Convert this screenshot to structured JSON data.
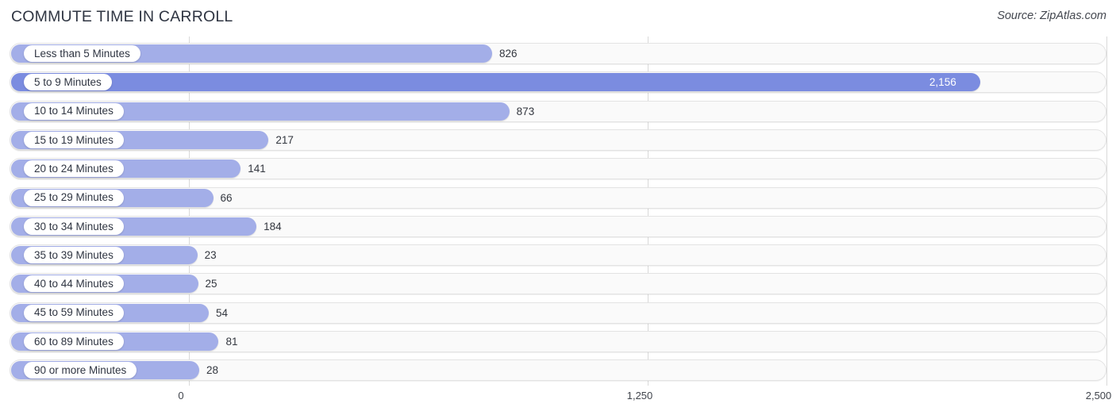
{
  "header": {
    "title": "COMMUTE TIME IN CARROLL",
    "source": "Source: ZipAtlas.com"
  },
  "chart_data": {
    "type": "bar",
    "orientation": "horizontal",
    "title": "COMMUTE TIME IN CARROLL",
    "xlabel": "",
    "ylabel": "",
    "xlim": [
      0,
      2500
    ],
    "grid": true,
    "legend": "none",
    "xticks": [
      0,
      1250,
      2500
    ],
    "xtick_labels": [
      "0",
      "1,250",
      "2,500"
    ],
    "categories": [
      "Less than 5 Minutes",
      "5 to 9 Minutes",
      "10 to 14 Minutes",
      "15 to 19 Minutes",
      "20 to 24 Minutes",
      "25 to 29 Minutes",
      "30 to 34 Minutes",
      "35 to 39 Minutes",
      "40 to 44 Minutes",
      "45 to 59 Minutes",
      "60 to 89 Minutes",
      "90 or more Minutes"
    ],
    "values": [
      826,
      2156,
      873,
      217,
      141,
      66,
      184,
      23,
      25,
      54,
      81,
      28
    ],
    "value_labels": [
      "826",
      "2,156",
      "873",
      "217",
      "141",
      "66",
      "184",
      "23",
      "25",
      "54",
      "81",
      "28"
    ],
    "highlight_index": 1,
    "colors": {
      "bar": "#a3aee8",
      "bar_highlight": "#7b8ce0",
      "track": "#fafafa",
      "track_border": "#e3e3e3",
      "gridline": "#d9d9d9",
      "text": "#2f3542",
      "value_text_inside": "#ffffff"
    }
  }
}
